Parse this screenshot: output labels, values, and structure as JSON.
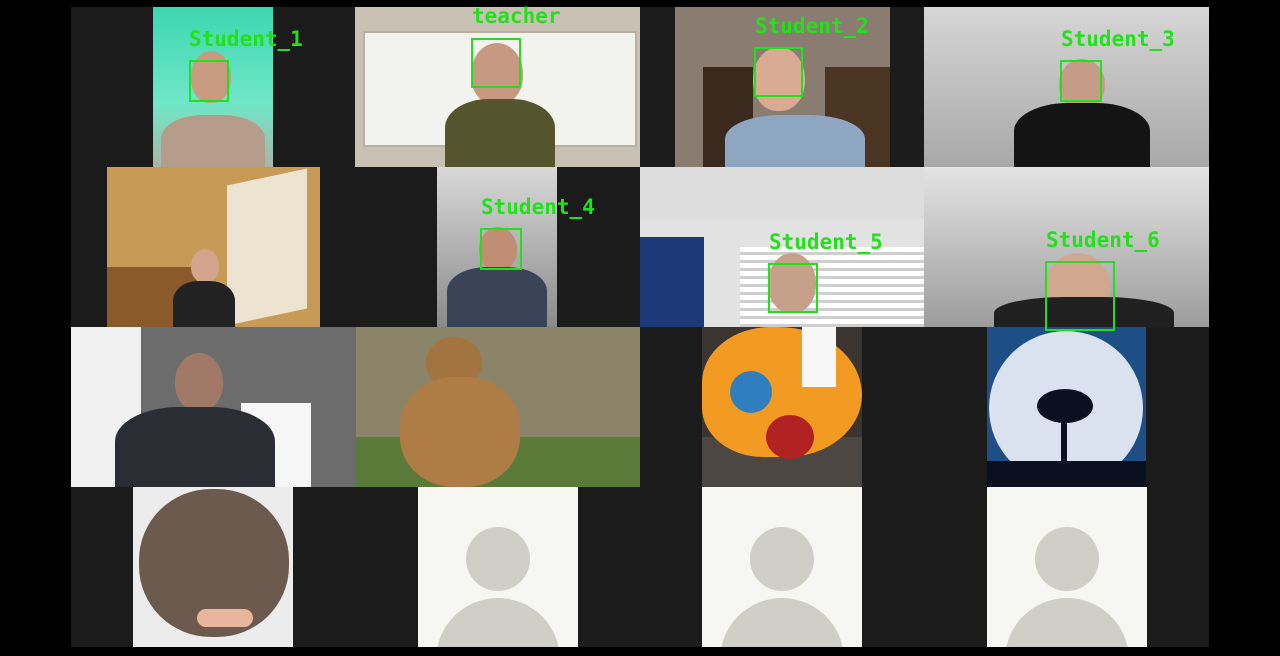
{
  "participants": [
    {
      "label": "Student_1"
    },
    {
      "label": "teacher"
    },
    {
      "label": "Student_2"
    },
    {
      "label": "Student_3"
    },
    {
      "label": "Student_4"
    },
    {
      "label": "Student_5"
    },
    {
      "label": "Student_6"
    }
  ],
  "colors": {
    "background": "#000000",
    "grid": "#1b1b1b",
    "detection": "#22e01c",
    "placeholder_tile": "#f6f6f2",
    "placeholder_avatar": "#cfcfc8"
  },
  "tiles": [
    {
      "kind": "video",
      "icon": "person-video"
    },
    {
      "kind": "video",
      "icon": "teacher-video"
    },
    {
      "kind": "video",
      "icon": "person-video"
    },
    {
      "kind": "video",
      "icon": "person-video"
    },
    {
      "kind": "video",
      "icon": "person-video"
    },
    {
      "kind": "video",
      "icon": "person-video"
    },
    {
      "kind": "video",
      "icon": "person-video"
    },
    {
      "kind": "video",
      "icon": "person-video"
    },
    {
      "kind": "video",
      "icon": "person-video"
    },
    {
      "kind": "image",
      "icon": "bear-image"
    },
    {
      "kind": "image",
      "icon": "clownfish-plush-image"
    },
    {
      "kind": "image",
      "icon": "moon-tree-image"
    },
    {
      "kind": "image",
      "icon": "seal-image"
    },
    {
      "kind": "avatar",
      "icon": "default-avatar-icon"
    },
    {
      "kind": "avatar",
      "icon": "default-avatar-icon"
    },
    {
      "kind": "avatar",
      "icon": "default-avatar-icon"
    }
  ]
}
